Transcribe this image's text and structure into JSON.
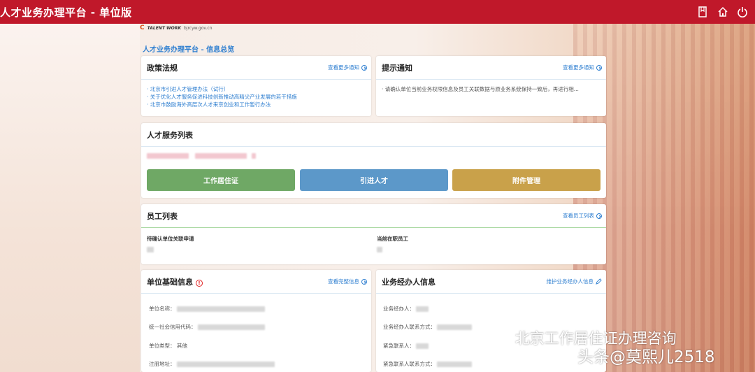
{
  "app": {
    "title": "人才业务办理平台 - 单位版"
  },
  "header_icons": [
    "bookmark-icon",
    "home-icon",
    "power-icon"
  ],
  "logo": {
    "brand": "TALENT WORK",
    "url": "bjrcyw.gov.cn"
  },
  "breadcrumb": "人才业务办理平台 - 信息总览",
  "policy": {
    "title": "政策法规",
    "more": "查看更多通知",
    "items": [
      "· 北京市引进人才管理办法（试行）",
      "· 关于优化人才服务促进科技创新推动高精尖产业发展的若干措施",
      "· 北京市鼓励海外高层次人才来京创业和工作暂行办法"
    ]
  },
  "notice": {
    "title": "提示通知",
    "more": "查看更多通知",
    "items": [
      "· 请确认单位当前业务权限信息及员工关联数据与原业务系统保持一致后，再进行相..."
    ]
  },
  "services": {
    "title": "人才服务列表",
    "buttons": [
      {
        "label": "工作居住证",
        "color": "#6fa865"
      },
      {
        "label": "引进人才",
        "color": "#5c98c9"
      },
      {
        "label": "附件管理",
        "color": "#c9a14a"
      }
    ]
  },
  "employees": {
    "title": "员工列表",
    "more": "查看员工列表",
    "pending_label": "待确认单位关联申请",
    "current_label": "当前在职员工"
  },
  "unit_info": {
    "title": "单位基础信息",
    "more": "查看完整信息",
    "fields": [
      "单位名称：",
      "统一社会信用代码：",
      "单位类型：",
      "注册地址："
    ],
    "type_value": "其他"
  },
  "agent_info": {
    "title": "业务经办人信息",
    "more": "维护业务经办人信息",
    "fields": [
      "业务经办人：",
      "业务经办人联系方式：",
      "紧急联系人：",
      "紧急联系人联系方式："
    ]
  },
  "watermark": {
    "line1": "北京工作居住证办理咨询",
    "line2": "头条@莫熙儿2518"
  },
  "colors": {
    "topbar": "#c0182a",
    "link": "#2f7fd0"
  }
}
